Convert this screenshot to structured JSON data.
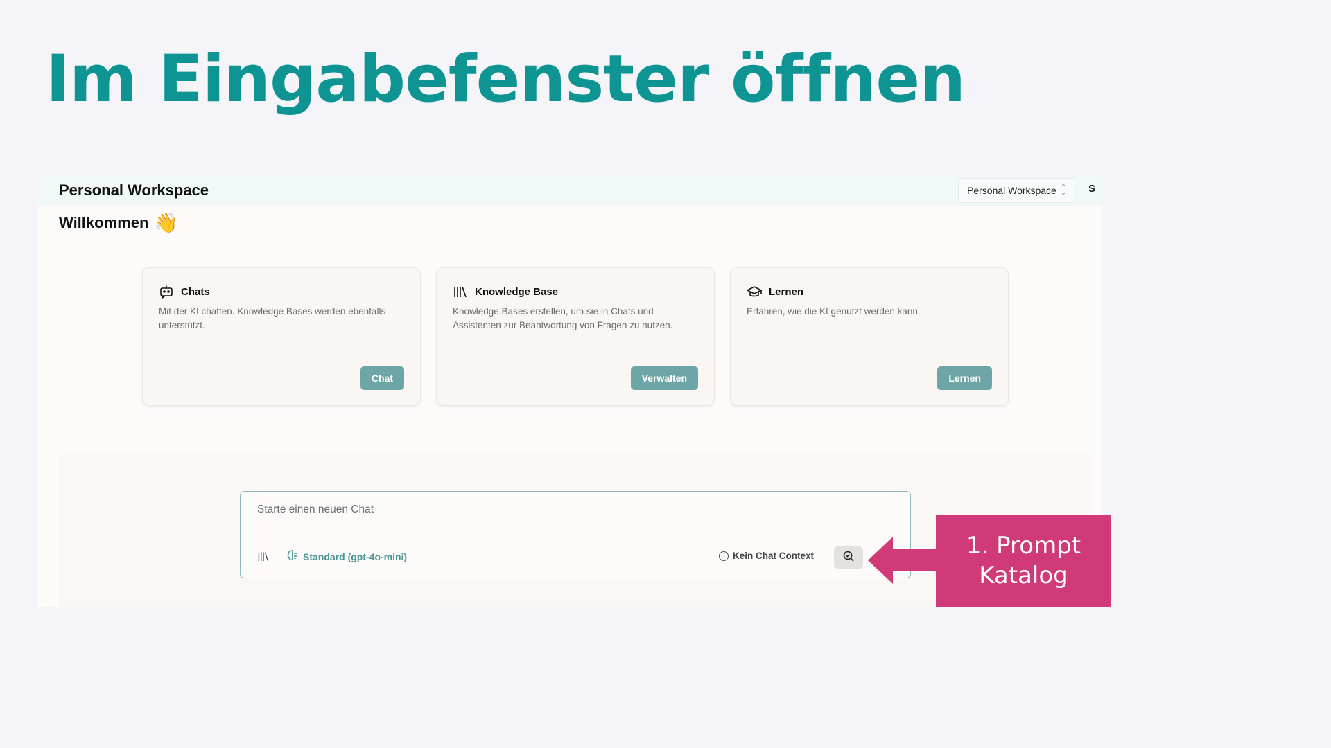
{
  "slide": {
    "title": "Im Eingabefenster öffnen",
    "callout": "1. Prompt Katalog",
    "accent_color": "#0e9593",
    "callout_color": "#d13a78"
  },
  "header": {
    "title": "Personal Workspace",
    "workspace_select": "Personal Workspace",
    "avatar": "S"
  },
  "welcome": {
    "text": "Willkommen",
    "emoji": "👋"
  },
  "cards": [
    {
      "icon": "bot-icon",
      "title": "Chats",
      "description": "Mit der KI chatten. Knowledge Bases werden ebenfalls unterstützt.",
      "button": "Chat"
    },
    {
      "icon": "library-icon",
      "title": "Knowledge Base",
      "description": "Knowledge Bases erstellen, um sie in Chats und Assistenten zur Beantwortung von Fragen zu nutzen.",
      "button": "Verwalten"
    },
    {
      "icon": "graduation-cap-icon",
      "title": "Lernen",
      "description": "Erfahren, wie die KI genutzt werden kann.",
      "button": "Lernen"
    }
  ],
  "chat": {
    "placeholder": "Starte einen neuen Chat",
    "model": "Standard (gpt-4o-mini)",
    "context_label": "Kein Chat Context",
    "button_color": "#6ea6a7"
  }
}
